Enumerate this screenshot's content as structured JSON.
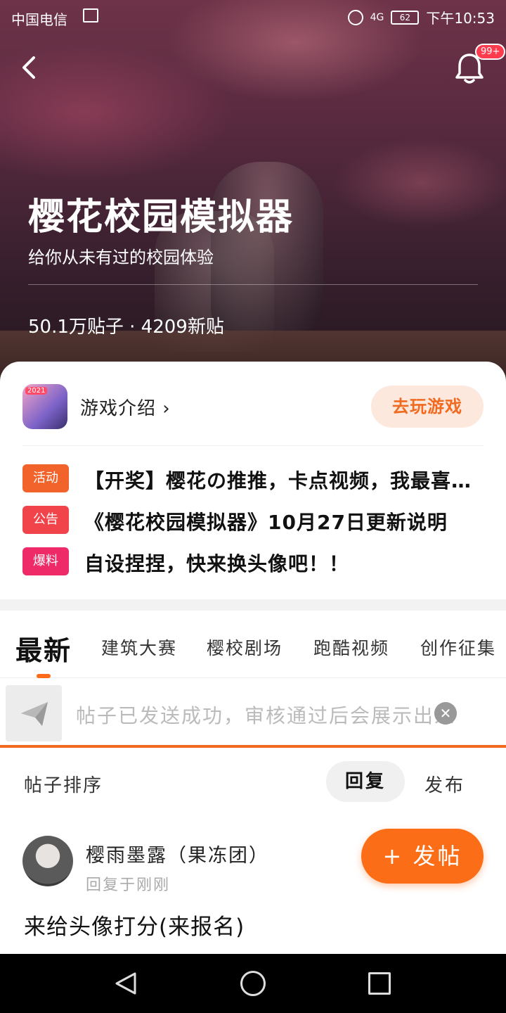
{
  "status_bar": {
    "carrier": "中国电信",
    "signal": "4G",
    "battery": "62",
    "time": "下午10:53"
  },
  "header": {
    "notification_badge": "99+"
  },
  "hero": {
    "title": "樱花校园模拟器",
    "subtitle": "给你从未有过的校园体验",
    "stats": "50.1万贴子 · 4209新贴"
  },
  "card": {
    "app_icon_tag": "2021",
    "intro_label": "游戏介绍 ›",
    "play_button": "去玩游戏",
    "notices": [
      {
        "badge": "活动",
        "color": "#f2622b",
        "text": "【开奖】樱花の推推，卡点视频，我最喜欢的角色"
      },
      {
        "badge": "公告",
        "color": "#f0434a",
        "text": "《樱花校园模拟器》10月27日更新说明"
      },
      {
        "badge": "爆料",
        "color": "#ee2a68",
        "text": "自设捏捏，快来换头像吧！！"
      }
    ]
  },
  "tabs": {
    "items": [
      "最新",
      "建筑大赛",
      "樱校剧场",
      "跑酷视频",
      "创作征集"
    ]
  },
  "send_banner": {
    "text": "帖子已发送成功，审核通过后会展示出来",
    "close": "✕"
  },
  "sort": {
    "label": "帖子排序",
    "reply": "回复",
    "post": "发布"
  },
  "post": {
    "author": "樱雨墨露（果冻团）",
    "meta": "回复于刚刚",
    "title": "来给头像打分(来报名)"
  },
  "fab": {
    "label": "+ 发帖"
  },
  "colors": {
    "accent": "#fb6e17",
    "badge_red": "#ff3b4e"
  }
}
